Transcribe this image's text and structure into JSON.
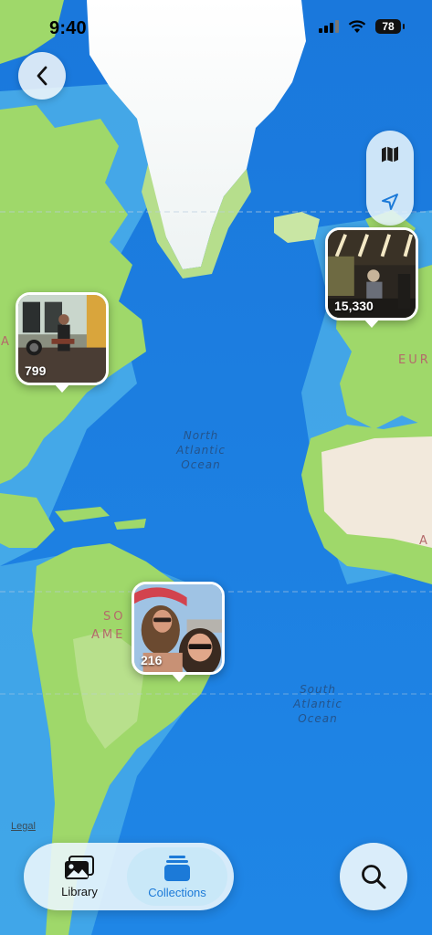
{
  "status_bar": {
    "time": "9:40",
    "battery": "78"
  },
  "map": {
    "ocean_labels": {
      "north": [
        "North",
        "Atlantic",
        "Ocean"
      ],
      "south": [
        "South",
        "Atlantic",
        "Ocean"
      ]
    },
    "land_labels": {
      "eur": "EUR",
      "a_europe": "A",
      "a_africa": "A",
      "so": "SO",
      "ame": "AME"
    },
    "legal": "Legal"
  },
  "pins": [
    {
      "count": "799",
      "subject": "band performing on patio"
    },
    {
      "count": "15,330",
      "subject": "concert stage with lights"
    },
    {
      "count": "216",
      "subject": "two women selfie at beach"
    }
  ],
  "controls": {
    "back_icon": "chevron-left-icon",
    "map_mode_icon": "map-icon",
    "location_icon": "location-arrow-icon",
    "search_icon": "magnifying-glass-icon"
  },
  "tab_bar": {
    "tabs": [
      {
        "label": "Library",
        "icon": "photo-stack-icon",
        "active": false
      },
      {
        "label": "Collections",
        "icon": "collections-stack-icon",
        "active": true
      }
    ]
  },
  "colors": {
    "accent": "#1c7ad8",
    "ocean": "#1f86e6",
    "land": "#9fd86a"
  }
}
